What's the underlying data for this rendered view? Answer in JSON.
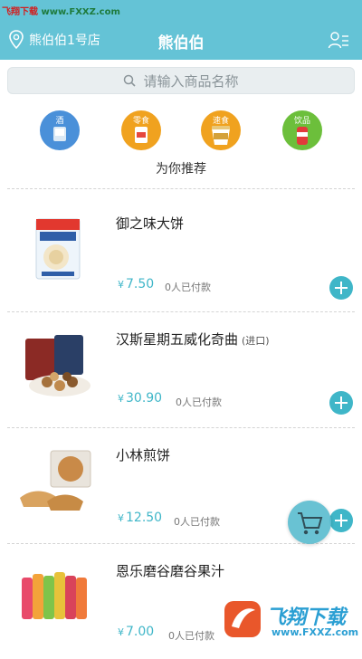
{
  "watermark_top": {
    "name": "飞翔下载",
    "url": "www.FXXZ.com"
  },
  "header": {
    "store_name": "熊伯伯1号店",
    "title": "熊伯伯",
    "accent": "#64c3d6"
  },
  "search": {
    "placeholder": "请输入商品名称"
  },
  "categories": [
    {
      "label": "酒",
      "color": "#4a90d9"
    },
    {
      "label": "零食",
      "color": "#f0a21f"
    },
    {
      "label": "速食",
      "color": "#f0a21f"
    },
    {
      "label": "饮品",
      "color": "#6cbf3b"
    }
  ],
  "section_title": "为你推荐",
  "currency": "¥",
  "products": [
    {
      "name": "御之味大饼",
      "tag": "",
      "price": "7.50",
      "sold": "0人已付款"
    },
    {
      "name": "汉斯星期五威化奇曲",
      "tag": "(进口)",
      "price": "30.90",
      "sold": "0人已付款"
    },
    {
      "name": "小林煎饼",
      "tag": "",
      "price": "12.50",
      "sold": "0人已付款"
    },
    {
      "name": "恩乐磨谷磨谷果汁",
      "tag": "",
      "price": "7.00",
      "sold": "0人已付款"
    }
  ],
  "watermark_bottom": {
    "name": "飞翔下载",
    "url": "www.FXXZ.com"
  },
  "icons": {
    "location": "location-pin-icon",
    "user": "user-list-icon",
    "search": "search-icon",
    "add": "plus-icon",
    "cart": "cart-icon"
  }
}
